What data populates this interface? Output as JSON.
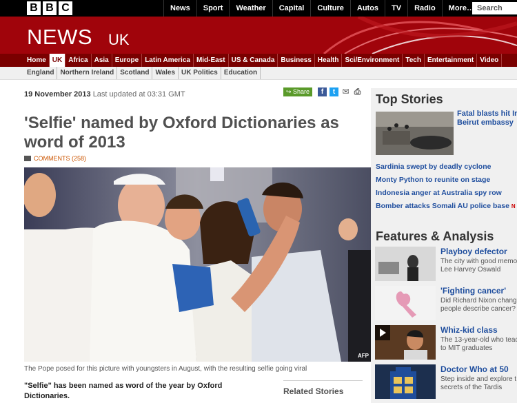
{
  "header": {
    "logo_letters": [
      "B",
      "B",
      "C"
    ],
    "nav": [
      "News",
      "Sport",
      "Weather",
      "Capital",
      "Culture",
      "Autos",
      "TV",
      "Radio",
      "More…"
    ],
    "search_placeholder": "Search"
  },
  "masthead": {
    "brand": "NEWS",
    "edition": "UK"
  },
  "section_nav": [
    "Home",
    "UK",
    "Africa",
    "Asia",
    "Europe",
    "Latin America",
    "Mid-East",
    "US & Canada",
    "Business",
    "Health",
    "Sci/Environment",
    "Tech",
    "Entertainment",
    "Video"
  ],
  "section_nav_active": "UK",
  "sub_nav": [
    "England",
    "Northern Ireland",
    "Scotland",
    "Wales",
    "UK Politics",
    "Education"
  ],
  "article": {
    "date": "19 November 2013",
    "updated": "Last updated at 03:31 GMT",
    "share_label": "Share",
    "headline": "'Selfie' named by Oxford Dictionaries as word of 2013",
    "comments": "COMMENTS (258)",
    "photo_credit": "AFP",
    "caption": "The Pope posed for this picture with youngsters in August, with the resulting selfie going viral",
    "intro": "\"Selfie\" has been named as word of the year by Oxford Dictionaries."
  },
  "related_title": "Related Stories",
  "top_stories": {
    "title": "Top Stories",
    "lead": [
      "Fatal blasts hit Ira",
      "Beirut embassy"
    ],
    "items": [
      {
        "text": "Sardinia swept by deadly cyclone"
      },
      {
        "text": "Monty Python to reunite on stage"
      },
      {
        "text": "Indonesia anger at Australia spy row"
      },
      {
        "text": "Bomber attacks Somali AU police base",
        "tag": "N"
      }
    ]
  },
  "features": {
    "title": "Features & Analysis",
    "items": [
      {
        "title": "Playboy defector",
        "desc": [
          "The city with good memo",
          "Lee Harvey Oswald"
        ]
      },
      {
        "title": "'Fighting cancer'",
        "desc": [
          "Did Richard Nixon chang",
          "people describe cancer?"
        ]
      },
      {
        "title": "Whiz-kid class",
        "desc": [
          "The 13-year-old who teac",
          "to MIT graduates"
        ]
      },
      {
        "title": "Doctor Who at 50",
        "desc": [
          "Step inside and explore t",
          "secrets of the Tardis"
        ]
      }
    ]
  }
}
